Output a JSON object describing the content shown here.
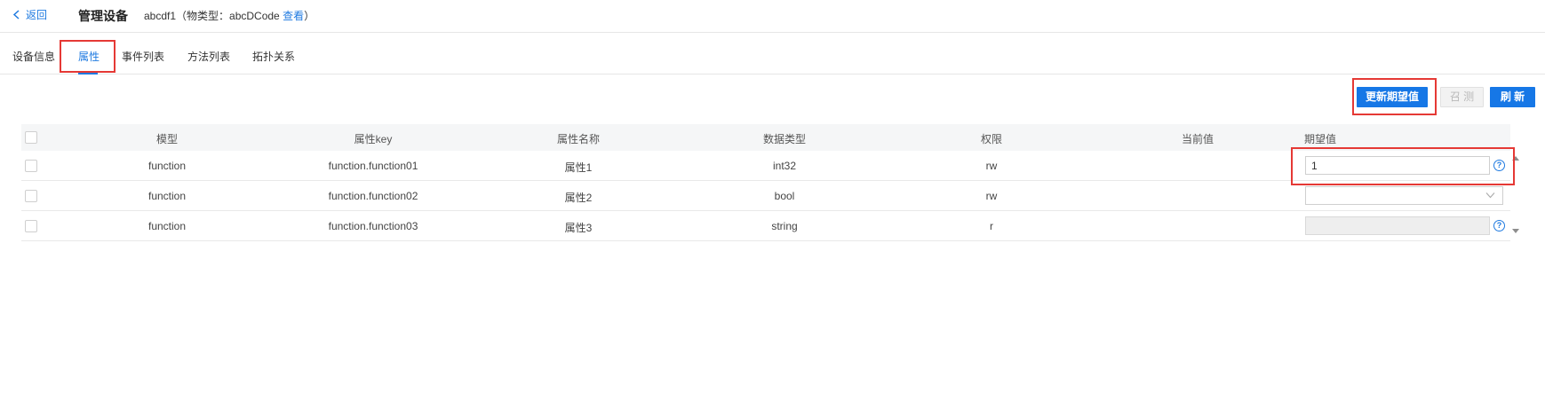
{
  "header": {
    "back_label": "返回",
    "title": "管理设备",
    "device_name": "abcdf1",
    "model_prefix": "（物类型：abcDCode ",
    "model_link": "查看",
    "model_suffix": "）"
  },
  "tabs": [
    {
      "label": "设备信息",
      "active": false
    },
    {
      "label": "属性",
      "active": true
    },
    {
      "label": "事件列表",
      "active": false
    },
    {
      "label": "方法列表",
      "active": false
    },
    {
      "label": "拓扑关系",
      "active": false
    }
  ],
  "toolbar": {
    "update_expected_label": "更新期望值",
    "call_label": "召 测",
    "refresh_label": "刷 新"
  },
  "table": {
    "columns": [
      "模型",
      "属性key",
      "属性名称",
      "数据类型",
      "权限",
      "当前值",
      "期望值"
    ],
    "rows": [
      {
        "model": "function",
        "key": "function.function01",
        "name": "属性1",
        "type": "int32",
        "permission": "rw",
        "current": "",
        "expected": "1",
        "expected_control": "input"
      },
      {
        "model": "function",
        "key": "function.function02",
        "name": "属性2",
        "type": "bool",
        "permission": "rw",
        "current": "",
        "expected": "",
        "expected_control": "select"
      },
      {
        "model": "function",
        "key": "function.function03",
        "name": "属性3",
        "type": "string",
        "permission": "r",
        "current": "",
        "expected": "",
        "expected_control": "disabled-input"
      }
    ]
  },
  "help_icon_glyph": "?",
  "colors": {
    "accent": "#1677e6",
    "highlight": "#e53935",
    "link": "#1f7ae0"
  }
}
